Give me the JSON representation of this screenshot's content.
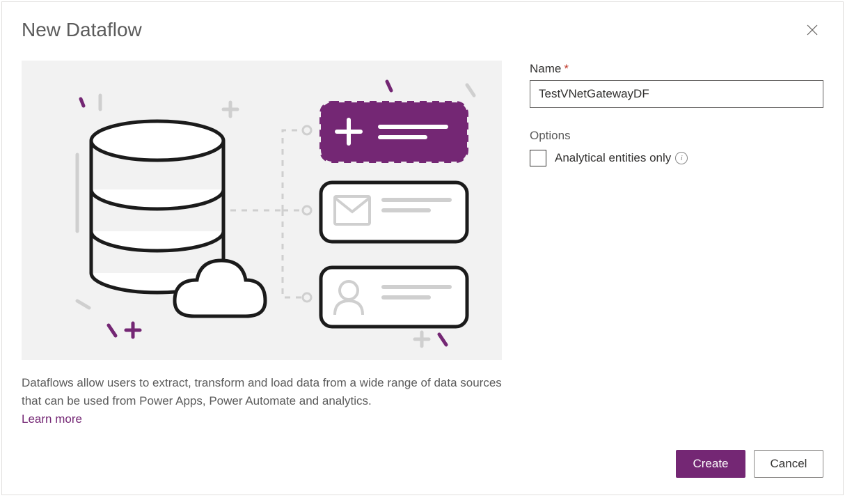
{
  "dialog": {
    "title": "New Dataflow",
    "description": "Dataflows allow users to extract, transform and load data from a wide range of data sources that can be used from Power Apps, Power Automate and analytics.",
    "learn_more_label": "Learn more"
  },
  "form": {
    "name_label": "Name",
    "name_value": "TestVNetGatewayDF",
    "options_label": "Options",
    "analytical_entities_label": "Analytical entities only",
    "analytical_entities_checked": false
  },
  "footer": {
    "create_label": "Create",
    "cancel_label": "Cancel"
  },
  "colors": {
    "accent": "#742774",
    "illustration_bg": "#f2f2f2"
  }
}
